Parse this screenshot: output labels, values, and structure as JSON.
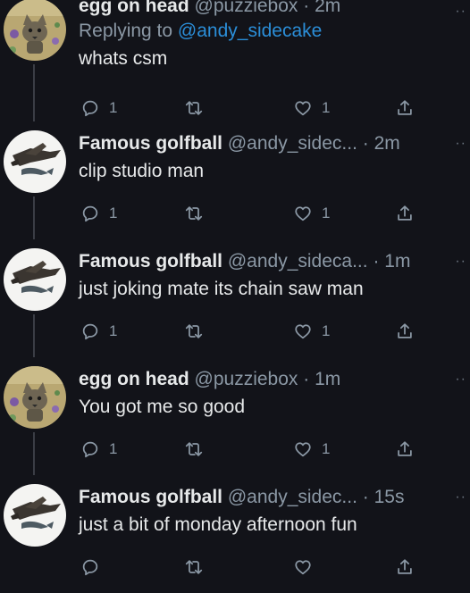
{
  "tweets": [
    {
      "name": "egg on head",
      "handle": "@puzziebox",
      "dot": "·",
      "time": "2m",
      "reply_prefix": "Replying to ",
      "reply_to": "@andy_sidecake",
      "text": "whats csm",
      "replies": "1",
      "retweets": "",
      "likes": "1",
      "avatar": "cat-avatar"
    },
    {
      "name": "Famous golfball",
      "handle": "@andy_sidec...",
      "dot": "·",
      "time": "2m",
      "text": "clip studio man",
      "replies": "1",
      "retweets": "",
      "likes": "1",
      "avatar": "bird-avatar"
    },
    {
      "name": "Famous golfball",
      "handle": "@andy_sideca...",
      "dot": "·",
      "time": "1m",
      "text": "just joking mate its chain saw man",
      "replies": "1",
      "retweets": "",
      "likes": "1",
      "avatar": "bird-avatar"
    },
    {
      "name": "egg on head",
      "handle": "@puzziebox",
      "dot": "·",
      "time": "1m",
      "text": "You got me so good",
      "replies": "1",
      "retweets": "",
      "likes": "1",
      "avatar": "cat-avatar"
    },
    {
      "name": "Famous golfball",
      "handle": "@andy_sidec...",
      "dot": "·",
      "time": "15s",
      "text": "just a bit of monday afternoon fun",
      "replies": "",
      "retweets": "",
      "likes": "",
      "avatar": "bird-avatar"
    }
  ],
  "more_glyph": "··",
  "colors": {
    "background": "#121319",
    "text": "#e7e9ea",
    "muted": "#8b98a5",
    "link": "#2b8ed8"
  },
  "icons": [
    "reply-icon",
    "retweet-icon",
    "like-icon",
    "share-icon",
    "more-icon"
  ]
}
